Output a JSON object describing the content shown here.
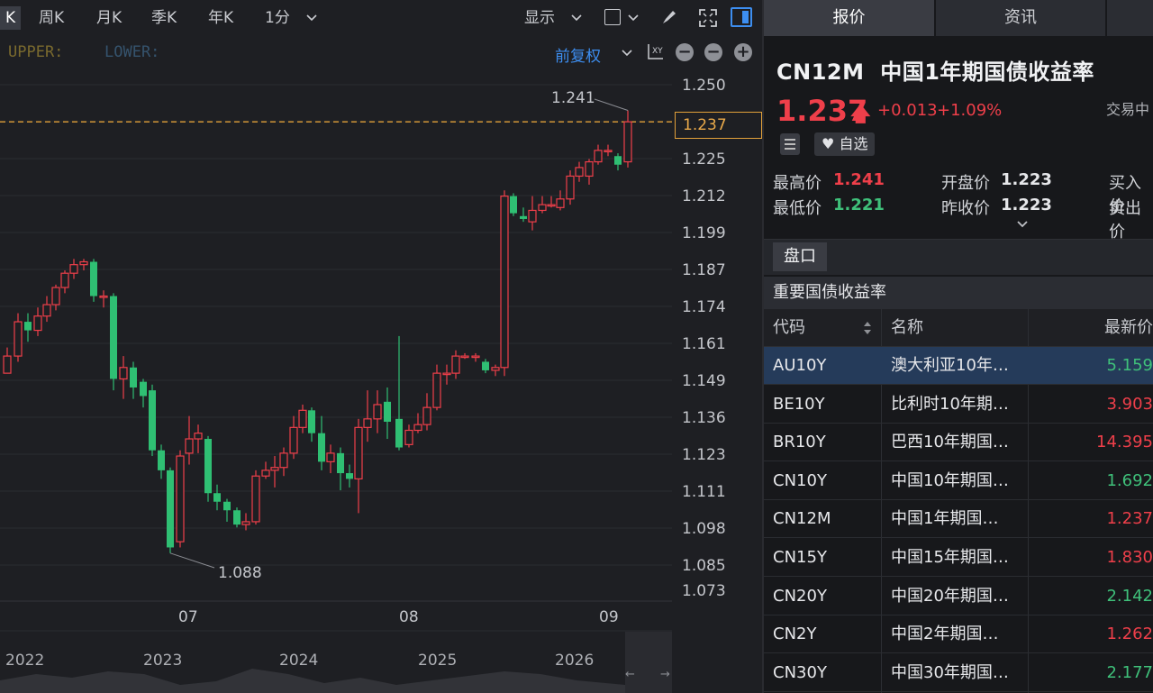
{
  "toolbar": {
    "active_period": "K",
    "periods": [
      "周K",
      "月K",
      "季K",
      "年K",
      "1分"
    ],
    "display": "显示",
    "adjust": "前复权"
  },
  "indicators": {
    "upper": "UPPER:",
    "lower": "LOWER:"
  },
  "chart": {
    "y_ticks": [
      "1.250",
      "1.237",
      "1.225",
      "1.212",
      "1.199",
      "1.187",
      "1.174",
      "1.161",
      "1.149",
      "1.136",
      "1.123",
      "1.111",
      "1.098",
      "1.085",
      "1.073"
    ],
    "current_price": "1.237",
    "high_label": "1.241",
    "low_label": "1.088",
    "x_ticks": [
      "07",
      "08",
      "09"
    ],
    "years": [
      "2022",
      "2023",
      "2024",
      "2025",
      "2026"
    ]
  },
  "chart_data": {
    "type": "candlestick",
    "ylim": [
      1.073,
      1.25
    ],
    "current": 1.237,
    "annotations": [
      {
        "text": "1.241",
        "kind": "high"
      },
      {
        "text": "1.088",
        "kind": "low"
      }
    ],
    "x_labels": [
      "07",
      "08",
      "09"
    ]
  },
  "tabs": [
    "报价",
    "资讯"
  ],
  "quote": {
    "symbol": "CN12M",
    "name": "中国1年期国债收益率",
    "price": "1.237",
    "change": "+0.013",
    "change_pct": "+1.09%",
    "status": "交易中",
    "watch": "自选",
    "high_label": "最高价",
    "high": "1.241",
    "low_label": "最低价",
    "low": "1.221",
    "open_label": "开盘价",
    "open": "1.223",
    "prev_label": "昨收价",
    "prev": "1.223",
    "bid_label": "买入价",
    "ask_label": "卖出价"
  },
  "pankou": "盘口",
  "section_title": "重要国债收益率",
  "table": {
    "headers": [
      "代码",
      "名称",
      "最新价"
    ],
    "rows": [
      {
        "code": "AU10Y",
        "name": "澳大利亚10年…",
        "price": "5.159",
        "color": "#3fc07a"
      },
      {
        "code": "BE10Y",
        "name": "比利时10年期…",
        "price": "3.903",
        "color": "#ef3f4a"
      },
      {
        "code": "BR10Y",
        "name": "巴西10年期国…",
        "price": "14.395",
        "color": "#ef3f4a"
      },
      {
        "code": "CN10Y",
        "name": "中国10年期国…",
        "price": "1.692",
        "color": "#3fc07a"
      },
      {
        "code": "CN12M",
        "name": "中国1年期国…",
        "price": "1.237",
        "color": "#ef3f4a"
      },
      {
        "code": "CN15Y",
        "name": "中国15年期国…",
        "price": "1.830",
        "color": "#ef3f4a"
      },
      {
        "code": "CN20Y",
        "name": "中国20年期国…",
        "price": "2.142",
        "color": "#3fc07a"
      },
      {
        "code": "CN2Y",
        "name": "中国2年期国…",
        "price": "1.262",
        "color": "#ef3f4a"
      },
      {
        "code": "CN30Y",
        "name": "中国30年期国…",
        "price": "2.177",
        "color": "#3fc07a"
      }
    ]
  }
}
